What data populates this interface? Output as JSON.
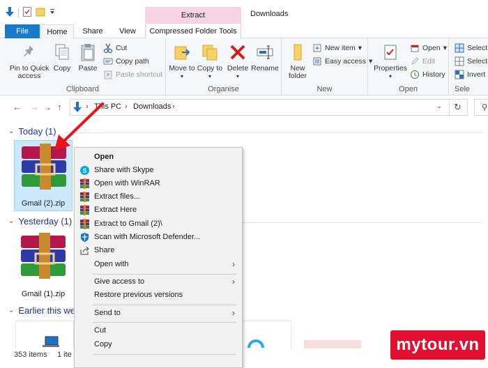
{
  "window": {
    "title": "Downloads",
    "contextual_tab_group": "Extract"
  },
  "ribbon_tabs": [
    "File",
    "Home",
    "Share",
    "View",
    "Compressed Folder Tools"
  ],
  "ribbon": {
    "clipboard": {
      "label": "Clipboard",
      "pin_to_quick_access": "Pin to Quick access",
      "copy": "Copy",
      "paste": "Paste",
      "cut": "Cut",
      "copy_path": "Copy path",
      "paste_shortcut": "Paste shortcut"
    },
    "organise": {
      "label": "Organise",
      "move_to": "Move to",
      "copy_to": "Copy to",
      "delete": "Delete",
      "rename": "Rename"
    },
    "new": {
      "label": "New",
      "new_folder": "New folder",
      "new_item": "New item",
      "easy_access": "Easy access"
    },
    "open": {
      "label": "Open",
      "properties": "Properties",
      "open": "Open",
      "edit": "Edit",
      "history": "History"
    },
    "select": {
      "label": "Sele",
      "select_all": "Select",
      "select_none": "Select",
      "invert": "Invert"
    }
  },
  "address_bar": {
    "path": [
      "This PC",
      "Downloads"
    ]
  },
  "content": {
    "groups": [
      {
        "title": "Today (1)",
        "files": [
          "Gmail (2).zip"
        ]
      },
      {
        "title": "Yesterday (1)",
        "files": [
          "Gmail (1).zip"
        ]
      },
      {
        "title": "Earlier this we",
        "files": []
      }
    ]
  },
  "status_bar": {
    "item_count": "353 items",
    "selected": "1 ite"
  },
  "context_menu": {
    "items": [
      {
        "label": "Open",
        "icon": "none",
        "bold": true
      },
      {
        "label": "Share with Skype",
        "icon": "skype-icon"
      },
      {
        "label": "Open with WinRAR",
        "icon": "winrar-icon"
      },
      {
        "label": "Extract files...",
        "icon": "winrar-icon"
      },
      {
        "label": "Extract Here",
        "icon": "winrar-icon"
      },
      {
        "label": "Extract to Gmail (2)\\",
        "icon": "winrar-icon"
      },
      {
        "label": "Scan with Microsoft Defender...",
        "icon": "defender-icon"
      },
      {
        "label": "Share",
        "icon": "share-icon"
      },
      {
        "label": "Open with",
        "submenu": true
      },
      {
        "label": "Give access to",
        "submenu": true
      },
      {
        "label": "Restore previous versions"
      },
      {
        "label": "Send to",
        "submenu": true
      },
      {
        "label": "Cut"
      },
      {
        "label": "Copy"
      }
    ]
  },
  "watermark": "mytour.vn",
  "colors": {
    "file_tab": "#1979ca",
    "contextual_tab": "#f7d3e4",
    "selection": "#cce8ff",
    "group_header": "#1e3287",
    "watermark": "#e0102e",
    "arrow": "#e8141c"
  }
}
